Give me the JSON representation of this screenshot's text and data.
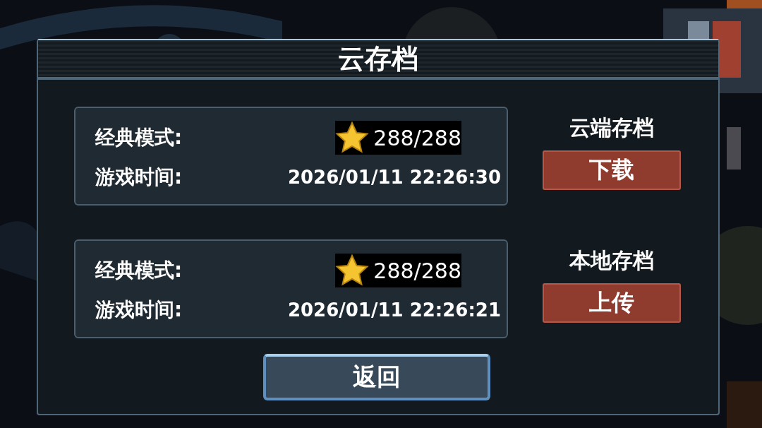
{
  "dialog": {
    "title": "云存档"
  },
  "saves": [
    {
      "mode_label": "经典模式:",
      "score": "288/288",
      "time_label": "游戏时间:",
      "time": "2026/01/11  22:26:30",
      "source_label": "云端存档",
      "action": "下载"
    },
    {
      "mode_label": "经典模式:",
      "score": "288/288",
      "time_label": "游戏时间:",
      "time": "2026/01/11  22:26:21",
      "source_label": "本地存档",
      "action": "上传"
    }
  ],
  "back_button": "返回"
}
